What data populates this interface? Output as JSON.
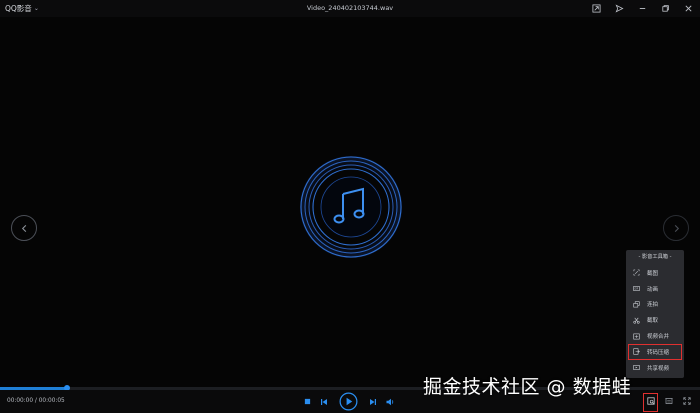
{
  "app": {
    "name": "QQ影音"
  },
  "window": {
    "title": "Video_240402103744.wav"
  },
  "toolbox": {
    "header": "- 影音工具箱 -",
    "items": [
      {
        "label": "截图",
        "icon": "screenshot-icon"
      },
      {
        "label": "动画",
        "icon": "animation-icon"
      },
      {
        "label": "连拍",
        "icon": "burst-shot-icon"
      },
      {
        "label": "截取",
        "icon": "scissors-icon"
      },
      {
        "label": "视频合并",
        "icon": "merge-icon"
      },
      {
        "label": "转码压缩",
        "icon": "transcode-icon",
        "highlighted": true
      },
      {
        "label": "共享视频",
        "icon": "share-icon"
      }
    ]
  },
  "player": {
    "time_current": "00:00:00",
    "time_total": "00:00:05",
    "progress_fraction": 0.095
  },
  "watermark": "掘金技术社区 @ 数据蛙",
  "colors": {
    "accent": "#1f7fd6",
    "highlight": "#e0302f",
    "disc": "#2f6fd0"
  }
}
